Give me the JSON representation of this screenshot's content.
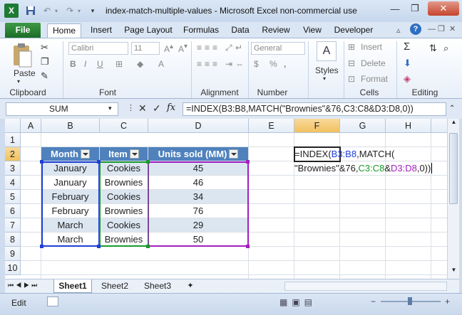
{
  "window": {
    "title": "index-match-multiple-values  -  Microsoft Excel non-commercial use",
    "minimize_icon": "minimize-icon",
    "restore_icon": "restore-icon",
    "close_icon": "close-icon"
  },
  "quick_access": {
    "excel_icon": "excel-logo-icon",
    "save_icon": "save-icon",
    "undo_icon": "undo-icon",
    "redo_icon": "redo-icon",
    "customize_icon": "chevron-down-icon"
  },
  "ribbon_tabs": [
    "File",
    "Home",
    "Insert",
    "Page Layout",
    "Formulas",
    "Data",
    "Review",
    "View",
    "Developer"
  ],
  "active_tab": "Home",
  "ribbon": {
    "clipboard": {
      "label": "Clipboard",
      "paste": "Paste"
    },
    "font": {
      "label": "Font",
      "font_name": "Calibri",
      "font_size": "11",
      "bold": "B",
      "italic": "I",
      "underline": "U"
    },
    "alignment": {
      "label": "Alignment"
    },
    "number": {
      "label": "Number",
      "format": "General",
      "currency": "$",
      "percent": "%",
      "comma": ","
    },
    "styles": {
      "label": "Styles"
    },
    "cells": {
      "label": "Cells",
      "insert": "Insert",
      "delete": "Delete",
      "format": "Format"
    },
    "editing": {
      "label": "Editing",
      "sum": "Σ"
    }
  },
  "formula_bar": {
    "name_box": "SUM",
    "cancel": "✕",
    "enter": "✓",
    "fx": "fx",
    "formula": "=INDEX(B3:B8,MATCH(\"Brownies\"&76,C3:C8&D3:D8,0))"
  },
  "columns": [
    "A",
    "B",
    "C",
    "D",
    "E",
    "F",
    "G",
    "H"
  ],
  "rows": [
    "1",
    "2",
    "3",
    "4",
    "5",
    "6",
    "7",
    "8",
    "9",
    "10"
  ],
  "table": {
    "headers": [
      "Month",
      "Item",
      "Units sold (MM)"
    ],
    "rows": [
      [
        "January",
        "Cookies",
        "45"
      ],
      [
        "January",
        "Brownies",
        "46"
      ],
      [
        "February",
        "Cookies",
        "34"
      ],
      [
        "February",
        "Brownies",
        "76"
      ],
      [
        "March",
        "Cookies",
        "29"
      ],
      [
        "March",
        "Brownies",
        "50"
      ]
    ]
  },
  "edit_cell": {
    "line1_pre": "=INDEX(",
    "line1_ref": "B3:B8",
    "line1_post": ",MATCH(",
    "line2_pre": "\"Brownies\"&76,",
    "line2_ref1": "C3:C8",
    "line2_amp": "&",
    "line2_ref2": "D3:D8",
    "line2_post": ",0))"
  },
  "sheets": [
    "Sheet1",
    "Sheet2",
    "Sheet3"
  ],
  "active_sheet": "Sheet1",
  "status": {
    "mode": "Edit"
  },
  "colors": {
    "header_fill": "#4f81bd",
    "band_fill": "#dce6f1",
    "ref_blue": "#1f3fd6",
    "ref_green": "#1a9a2a",
    "ref_purple": "#a020c0",
    "file_tab": "#2a7d36"
  }
}
